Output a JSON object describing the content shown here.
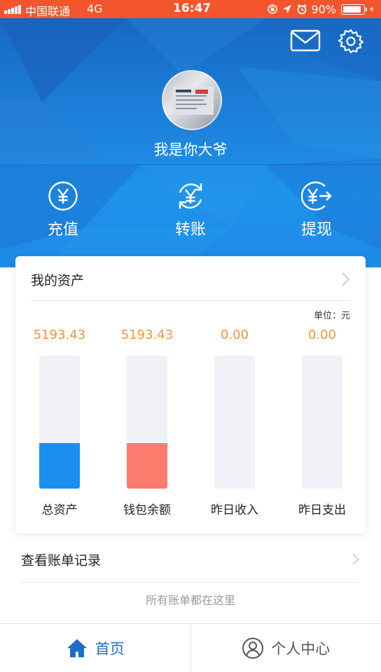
{
  "status_bar": {
    "carrier": "中国联通",
    "network": "4G",
    "time": "16:47",
    "battery": "90%",
    "battery_level": 0.9,
    "icons": [
      "signal-icon",
      "rotation-lock-icon",
      "location-icon",
      "alarm-icon",
      "battery-icon",
      "charging-icon"
    ]
  },
  "header": {
    "mail_icon": "mail-icon",
    "settings_icon": "gear-icon",
    "username": "我是你大爷",
    "actions": [
      {
        "label": "充值",
        "icon": "yuan-circle-icon"
      },
      {
        "label": "转账",
        "icon": "yuan-transfer-icon"
      },
      {
        "label": "提现",
        "icon": "yuan-withdraw-icon"
      }
    ]
  },
  "assets": {
    "title": "我的资产",
    "unit": "单位：元",
    "columns": [
      {
        "value": "5193.43",
        "label": "总资产",
        "fill_fraction": 0.34,
        "color": "#1a8ff0"
      },
      {
        "value": "5193.43",
        "label": "钱包余额",
        "fill_fraction": 0.34,
        "color": "#fb7b6c"
      },
      {
        "value": "0.00",
        "label": "昨日收入",
        "fill_fraction": 0,
        "color": "#1a8ff0"
      },
      {
        "value": "0.00",
        "label": "昨日支出",
        "fill_fraction": 0,
        "color": "#fb7b6c"
      }
    ]
  },
  "bills": {
    "title": "查看账单记录",
    "subtitle": "所有账单都在这里"
  },
  "tabbar": {
    "home_label": "首页",
    "profile_label": "个人中心"
  },
  "colors": {
    "status_bar": "#f4552c",
    "header_blue": "#1d83dc",
    "value_orange": "#f0953e",
    "active_tab": "#1c6fc8"
  }
}
